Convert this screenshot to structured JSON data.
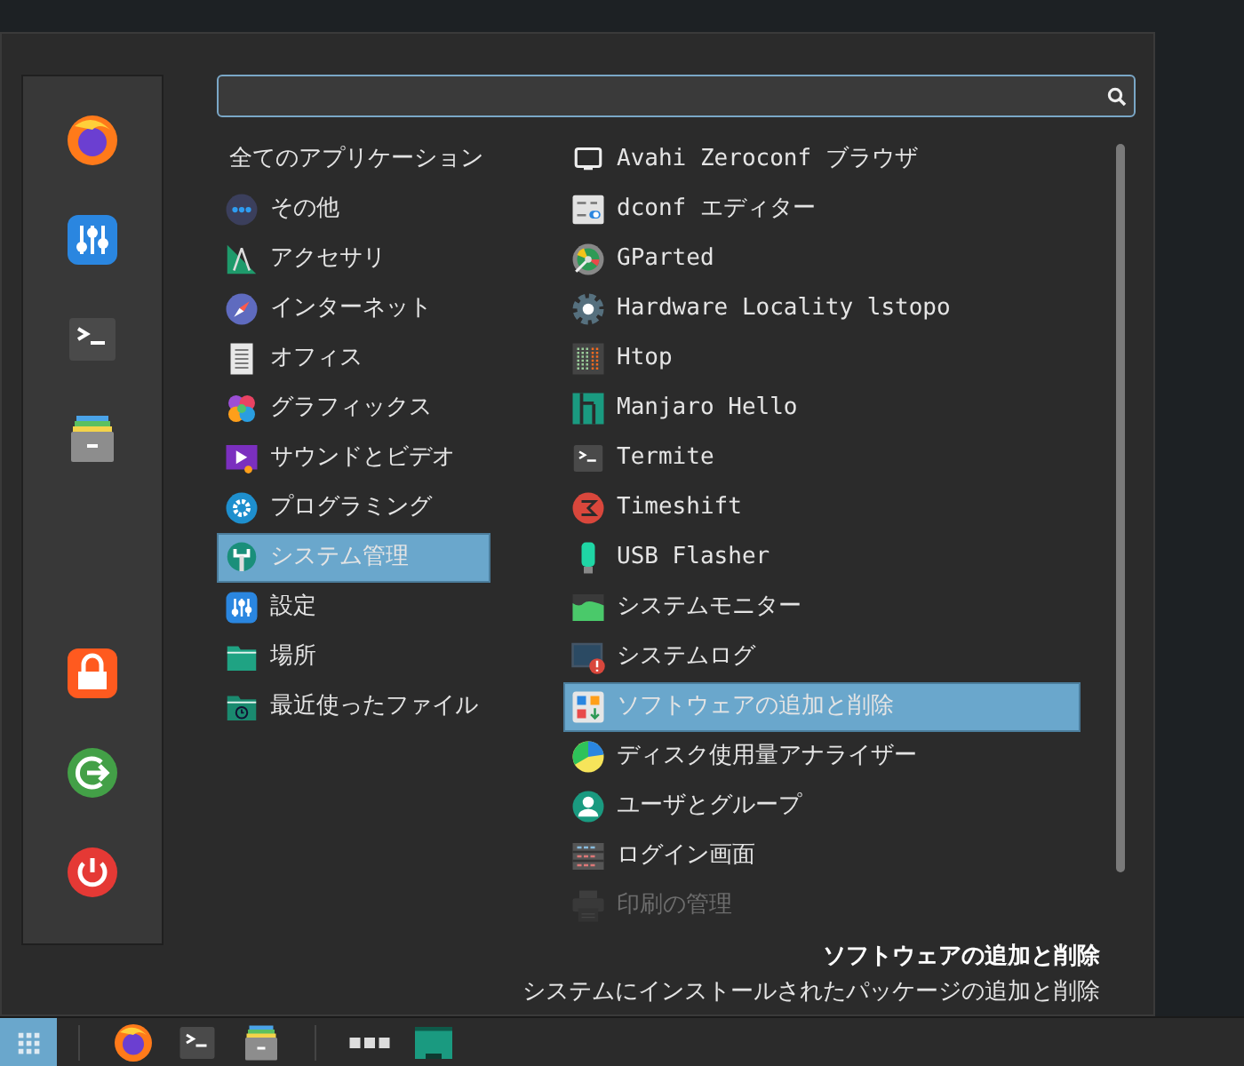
{
  "sidebar": {
    "top": [
      {
        "kind": "browser"
      },
      {
        "kind": "sliders"
      },
      {
        "kind": "terminal"
      },
      {
        "kind": "drawer"
      }
    ],
    "bottom": [
      {
        "kind": "lock"
      },
      {
        "kind": "logout"
      },
      {
        "kind": "power"
      }
    ]
  },
  "categories": [
    {
      "label": "全てのアプリケーション",
      "selected": false
    },
    {
      "label": "その他",
      "kind": "dots",
      "selected": false
    },
    {
      "label": "アクセサリ",
      "kind": "drafting",
      "selected": false
    },
    {
      "label": "インターネット",
      "kind": "compass",
      "selected": false
    },
    {
      "label": "オフィス",
      "kind": "document",
      "selected": false
    },
    {
      "label": "グラフィックス",
      "kind": "flower",
      "selected": false
    },
    {
      "label": "サウンドとビデオ",
      "kind": "video",
      "selected": false
    },
    {
      "label": "プログラミング",
      "kind": "gearcircle",
      "selected": false
    },
    {
      "label": "システム管理",
      "kind": "wrench",
      "selected": true
    },
    {
      "label": "設定",
      "kind": "sliders",
      "selected": false
    },
    {
      "label": "場所",
      "kind": "folder",
      "selected": false
    },
    {
      "label": "最近使ったファイル",
      "kind": "folderclock",
      "selected": false
    }
  ],
  "apps": [
    {
      "label": "Avahi Zeroconf ブラウザ",
      "kind": "monitor",
      "selected": false,
      "disabled": false
    },
    {
      "label": "dconf エディター",
      "kind": "panel",
      "selected": false,
      "disabled": false
    },
    {
      "label": "GParted",
      "kind": "disk",
      "selected": false,
      "disabled": false
    },
    {
      "label": "Hardware Locality lstopo",
      "kind": "gear",
      "selected": false,
      "disabled": false
    },
    {
      "label": "Htop",
      "kind": "bars",
      "selected": false,
      "disabled": false
    },
    {
      "label": "Manjaro Hello",
      "kind": "blocks",
      "selected": false,
      "disabled": false
    },
    {
      "label": "Termite",
      "kind": "terminal",
      "selected": false,
      "disabled": false
    },
    {
      "label": "Timeshift",
      "kind": "emblem",
      "selected": false,
      "disabled": false
    },
    {
      "label": "USB Flasher",
      "kind": "usb",
      "selected": false,
      "disabled": false
    },
    {
      "label": "システムモニター",
      "kind": "areachart",
      "selected": false,
      "disabled": false
    },
    {
      "label": "システムログ",
      "kind": "warning",
      "selected": false,
      "disabled": false
    },
    {
      "label": "ソフトウェアの追加と削除",
      "kind": "griddown",
      "selected": true,
      "disabled": false
    },
    {
      "label": "ディスク使用量アナライザー",
      "kind": "pie",
      "selected": false,
      "disabled": false
    },
    {
      "label": "ユーザとグループ",
      "kind": "user",
      "selected": false,
      "disabled": false
    },
    {
      "label": "ログイン画面",
      "kind": "server",
      "selected": false,
      "disabled": false
    },
    {
      "label": "印刷の管理",
      "kind": "printer",
      "selected": false,
      "disabled": true
    }
  ],
  "description": {
    "title": "ソフトウェアの追加と削除",
    "text": "システムにインストールされたパッケージの追加と削除"
  },
  "taskbar": {
    "groups": [
      [
        {
          "kind": "grid",
          "selected": true
        }
      ],
      [
        {
          "kind": "browser",
          "selected": false
        },
        {
          "kind": "terminal",
          "selected": false
        },
        {
          "kind": "drawer",
          "selected": false
        }
      ],
      [
        {
          "kind": "workspaces",
          "selected": false
        },
        {
          "kind": "window",
          "selected": false
        }
      ]
    ]
  }
}
